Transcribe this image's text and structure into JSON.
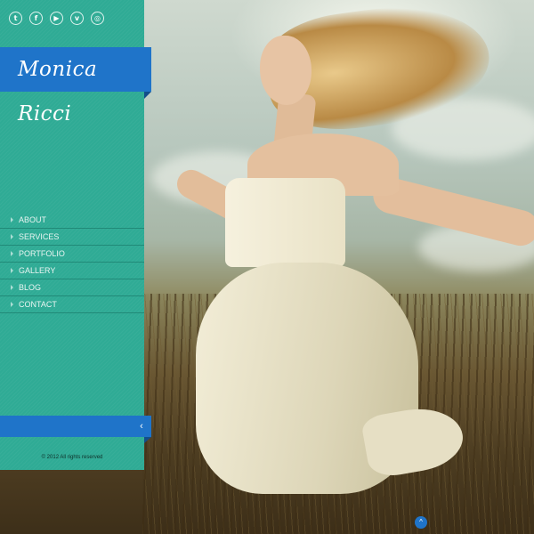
{
  "brand": {
    "name": "Monica Ricci"
  },
  "social": [
    {
      "icon": "twitter-icon",
      "glyph": "t"
    },
    {
      "icon": "facebook-icon",
      "glyph": "f"
    },
    {
      "icon": "youtube-icon",
      "glyph": "▶"
    },
    {
      "icon": "vimeo-icon",
      "glyph": "v"
    },
    {
      "icon": "dribbble-icon",
      "glyph": "◎"
    }
  ],
  "nav": {
    "items": [
      {
        "label": "ABOUT"
      },
      {
        "label": "SERVICES"
      },
      {
        "label": "PORTFOLIO"
      },
      {
        "label": "GALLERY"
      },
      {
        "label": "BLOG"
      },
      {
        "label": "CONTACT"
      }
    ]
  },
  "toggle": {
    "glyph": "‹"
  },
  "footer": {
    "copyright": "© 2012 All rights reserved"
  },
  "scroll_top": {
    "glyph": "^"
  },
  "colors": {
    "sidebar": "#2fab95",
    "accent": "#1f74c9"
  }
}
